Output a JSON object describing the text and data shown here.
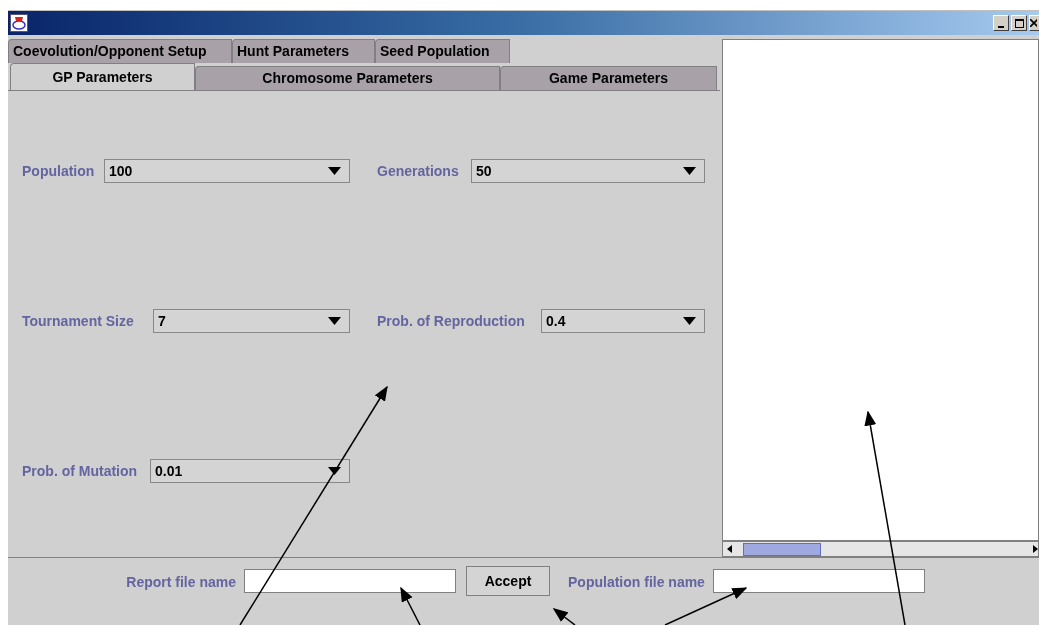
{
  "tabs_back_row": [
    {
      "label": "Coevolution/Opponent Setup",
      "selected": false
    },
    {
      "label": "Hunt Parameters",
      "selected": false
    },
    {
      "label": "Seed Population",
      "selected": false
    }
  ],
  "tabs_front_row": [
    {
      "label": "GP Parameters",
      "selected": true
    },
    {
      "label": "Chromosome Parameters",
      "selected": false
    },
    {
      "label": "Game Parameters",
      "selected": false
    }
  ],
  "parameter_rows": [
    [
      {
        "label": "Population",
        "value": "100"
      },
      {
        "label": "Generations",
        "value": "50"
      }
    ],
    [
      {
        "label": "Tournament Size",
        "value": "7"
      },
      {
        "label": "Prob. of Reproduction",
        "value": "0.4"
      }
    ],
    [
      {
        "label": "Prob. of Mutation",
        "value": "0.01"
      }
    ]
  ],
  "bottom_bar": {
    "report_label": "Report file name",
    "accept_button": "Accept",
    "population_label": "Population file name"
  }
}
